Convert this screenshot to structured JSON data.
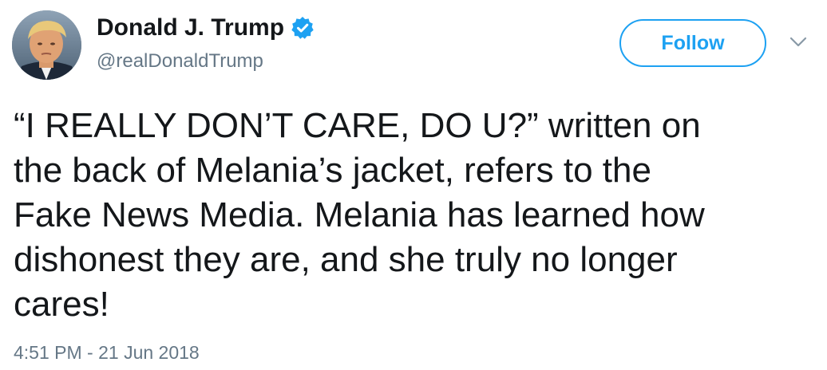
{
  "user": {
    "display_name": "Donald J. Trump",
    "handle": "@realDonaldTrump",
    "verified": true,
    "avatar_icon": "profile-photo"
  },
  "follow_button": {
    "label": "Follow"
  },
  "menu_icon": "chevron-down-icon",
  "tweet": {
    "text": "“I REALLY DON’T CARE, DO U?” written on\nthe back of Melania’s jacket, refers to the\nFake News Media. Melania has learned how\ndishonest they are, and she truly no longer\ncares!",
    "timestamp": "4:51 PM - 21 Jun 2018"
  },
  "colors": {
    "accent": "#1da1f2",
    "text_primary": "#14171a",
    "text_secondary": "#657786",
    "background": "#ffffff"
  }
}
